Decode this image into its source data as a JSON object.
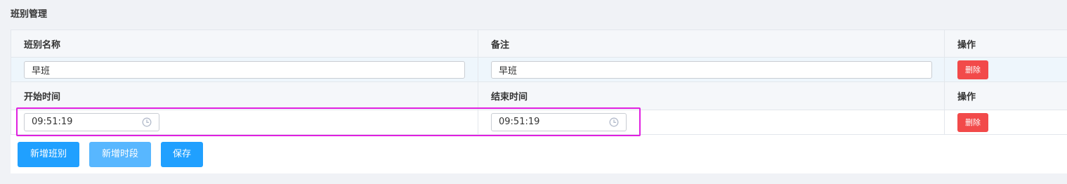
{
  "page_title": "班别管理",
  "shift_table": {
    "headers": {
      "name": "班别名称",
      "remark": "备注",
      "action": "操作"
    },
    "row": {
      "name_value": "早班",
      "remark_value": "早班",
      "delete_label": "删除"
    }
  },
  "period_table": {
    "headers": {
      "start": "开始时间",
      "end": "结束时间",
      "action": "操作"
    },
    "row": {
      "start_time": "09:51:19",
      "end_time": "09:51:19",
      "delete_label": "删除"
    }
  },
  "buttons": {
    "add_shift": "新增班别",
    "add_period": "新增时段",
    "save": "保存"
  },
  "icons": {
    "time": "clock-icon"
  },
  "colors": {
    "primary": "#20a0ff",
    "primary_light": "#58b7ff",
    "danger": "#f24a4a",
    "highlight": "#e020e0"
  }
}
